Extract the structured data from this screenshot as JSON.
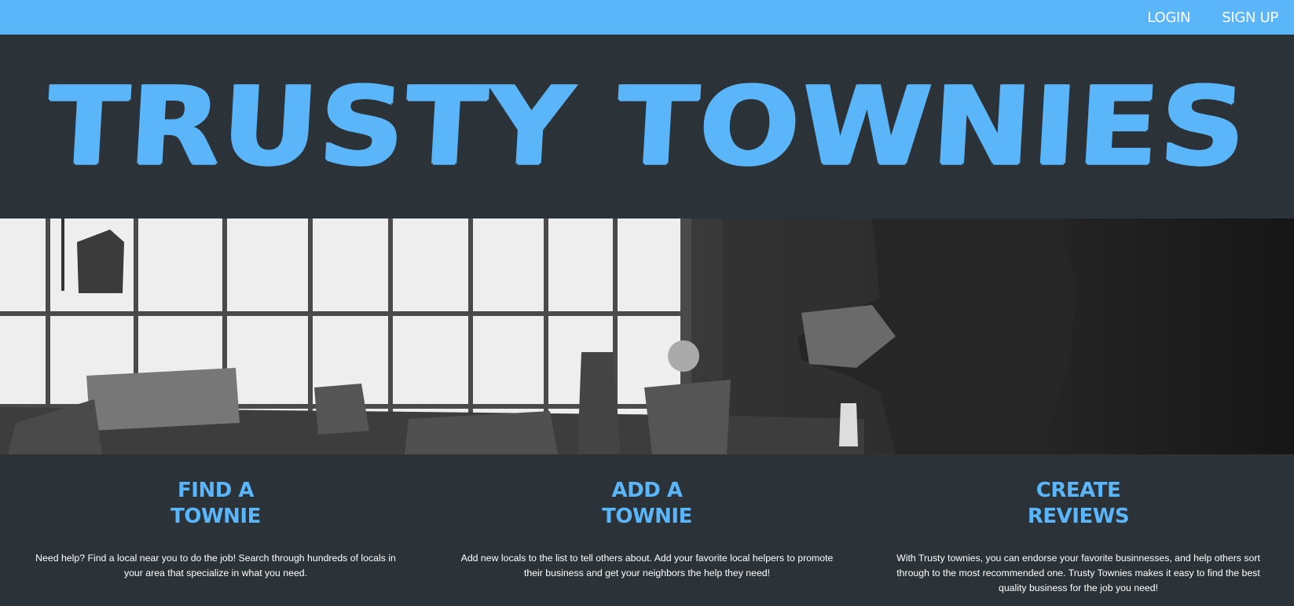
{
  "nav": {
    "login": "LOGIN",
    "signup": "SIGN UP"
  },
  "hero": {
    "title": "TRUSTY TOWNIES"
  },
  "banner": {
    "image_description_icon": "workshop-photo"
  },
  "features": [
    {
      "title_line1": "FIND A",
      "title_line2": "TOWNIE",
      "text": "Need help? Find a local near you to do the job! Search through hundreds of locals in your area that specialize in what you need."
    },
    {
      "title_line1": "ADD A",
      "title_line2": "TOWNIE",
      "text": "Add new locals to the list to tell others about. Add your favorite local helpers to promote their business and get your neighbors the help they need!"
    },
    {
      "title_line1": "CREATE",
      "title_line2": "REVIEWS",
      "text": "With Trusty townies, you can endorse your favorite businnesses, and help others sort through to the most recommended one. Trusty Townies makes it easy to find the best quality business for the job you need!"
    }
  ],
  "colors": {
    "accent": "#5ab5f9",
    "background": "#2c3338"
  }
}
